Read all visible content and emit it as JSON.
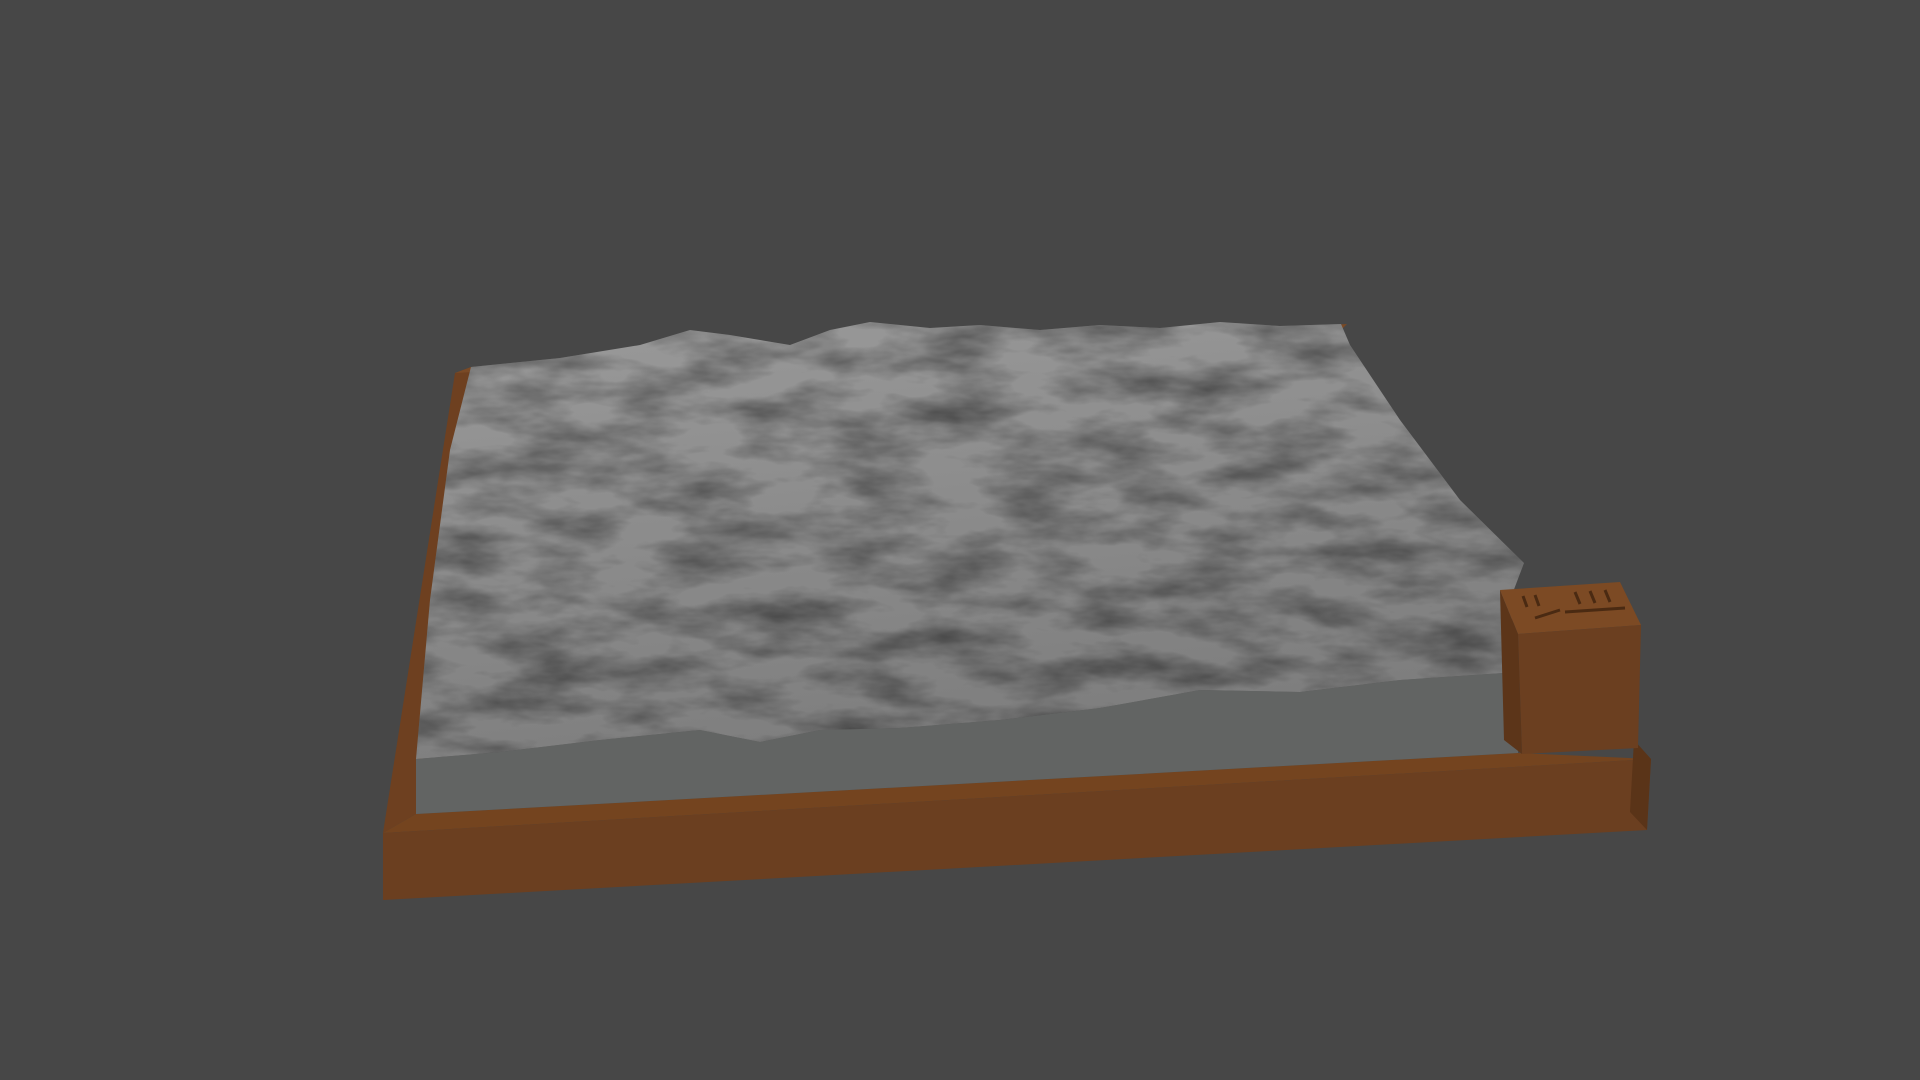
{
  "scene": {
    "background_color": "#474747",
    "base_color": "#6b3f20",
    "terrain_color": "#8e8e8e",
    "side_color": "#626463"
  }
}
